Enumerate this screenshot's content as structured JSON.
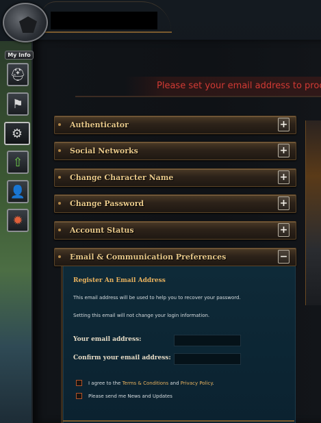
{
  "sidebar": {
    "my_info_label": "My Info",
    "tabs": [
      {
        "icon": "helmet-icon"
      },
      {
        "icon": "banner-icon"
      },
      {
        "icon": "gear-icon",
        "active": true
      },
      {
        "icon": "upgrade-arrow-icon"
      },
      {
        "icon": "add-friend-icon"
      },
      {
        "icon": "bomb-icon"
      }
    ]
  },
  "banner": {
    "text": "Please set your email address to proceed"
  },
  "accordion": [
    {
      "label": "Authenticator",
      "toggle": "+"
    },
    {
      "label": "Social Networks",
      "toggle": "+"
    },
    {
      "label": "Change Character Name",
      "toggle": "+"
    },
    {
      "label": "Change Password",
      "toggle": "+"
    },
    {
      "label": "Account Status",
      "toggle": "+"
    },
    {
      "label": "Email & Communication Preferences",
      "toggle": "−"
    }
  ],
  "email_panel": {
    "title": "Register An Email Address",
    "info1": "This email address will be used to help you to recover your password.",
    "info2": "Setting this email will not change your login information.",
    "email_label": "Your email address:",
    "email_value": "",
    "confirm_label": "Confirm your email address:",
    "confirm_value": "",
    "agree_prefix": "I agree to the ",
    "terms_link": "Terms & Conditions",
    "agree_and": " and ",
    "privacy_link": "Privacy Policy",
    "agree_suffix": ".",
    "news_label": "Please send me News and Updates"
  },
  "colors": {
    "banner_text": "#d23a34",
    "accordion_text": "#e9c98a",
    "panel_bg": "#0e2a38",
    "link": "#e9b25e"
  }
}
